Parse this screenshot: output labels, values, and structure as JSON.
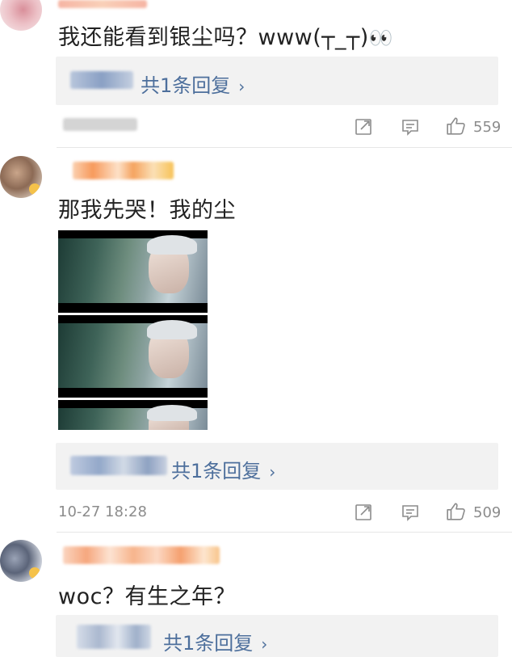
{
  "comments": [
    {
      "text": "我还能看到银尘吗？www(┬_┬)",
      "emoji": "👀",
      "reply_label": "共1条回复",
      "likes": "559"
    },
    {
      "text": "那我先哭！我的尘",
      "reply_label": "共1条回复",
      "timestamp": "10-27 18:28",
      "likes": "509"
    },
    {
      "text": "woc？有生之年？",
      "reply_label": "共1条回复"
    }
  ],
  "icons": {
    "share": "share-icon",
    "comment": "comment-icon",
    "like": "thumbs-up-icon",
    "chevron": "chevron-right-icon"
  },
  "colors": {
    "link": "#4d6f9c",
    "meta": "#8c8c8c",
    "reply_bg": "#f2f2f2"
  }
}
